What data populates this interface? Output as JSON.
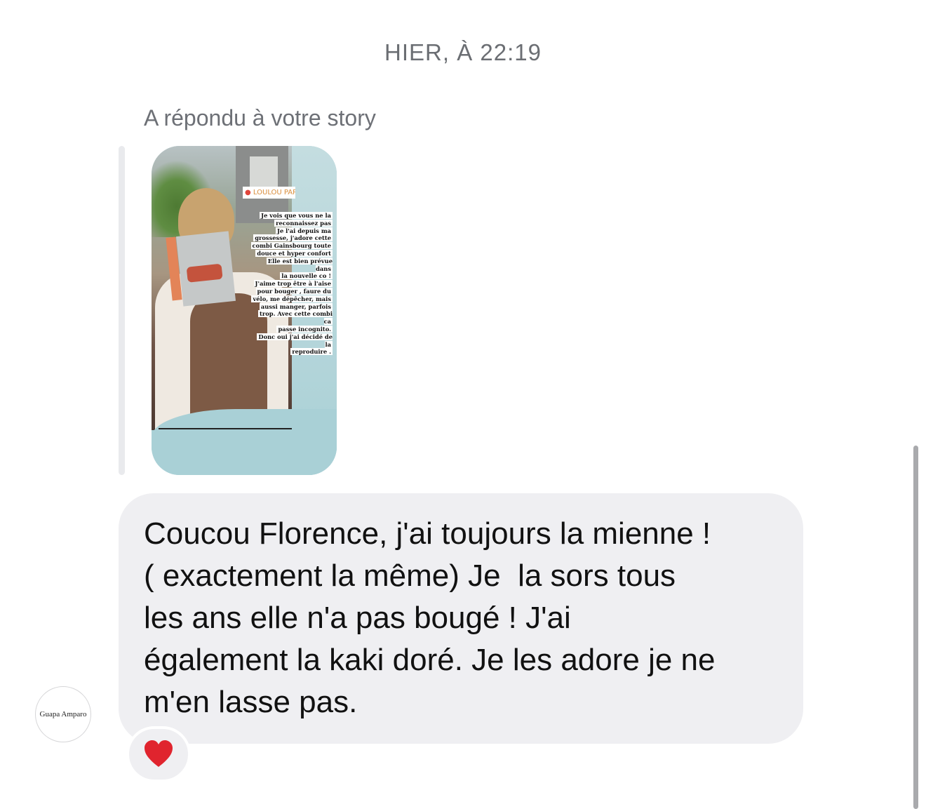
{
  "conversation": {
    "timestamp": "HIER, À 22:19",
    "reply_context": "A répondu à votre story",
    "story": {
      "location_sticker": "LOULOU PAR",
      "caption_lines": [
        "Je vois que vous ne la",
        "reconnaissez pas",
        "Je l'ai depuis ma",
        "grossesse, j'adore cette",
        "combi Gainsbourg toute",
        "douce et hyper confort",
        "Elle est bien prévue dans",
        "la nouvelle co !",
        "J'aime trop être à l'aise",
        "pour bouger , faure du",
        "vélo, me dépêcher, mais",
        "aussi manger, parfois",
        "trop. Avec cette combi ca",
        "passe incognito.",
        "Donc oui j'ai décidé de la",
        "reproduire ."
      ]
    },
    "message": {
      "text": "Coucou Florence, j'ai toujours la mienne !\n( exactement la même) Je  la sors tous\nles ans elle n'a pas bougé ! J'ai\négalement la kaki doré. Je les adore je ne\nm'en lasse pas."
    },
    "sender": {
      "avatar_text": "Guapa Amparo"
    },
    "reaction": {
      "icon": "red-heart-icon",
      "color": "#e0242e"
    }
  }
}
